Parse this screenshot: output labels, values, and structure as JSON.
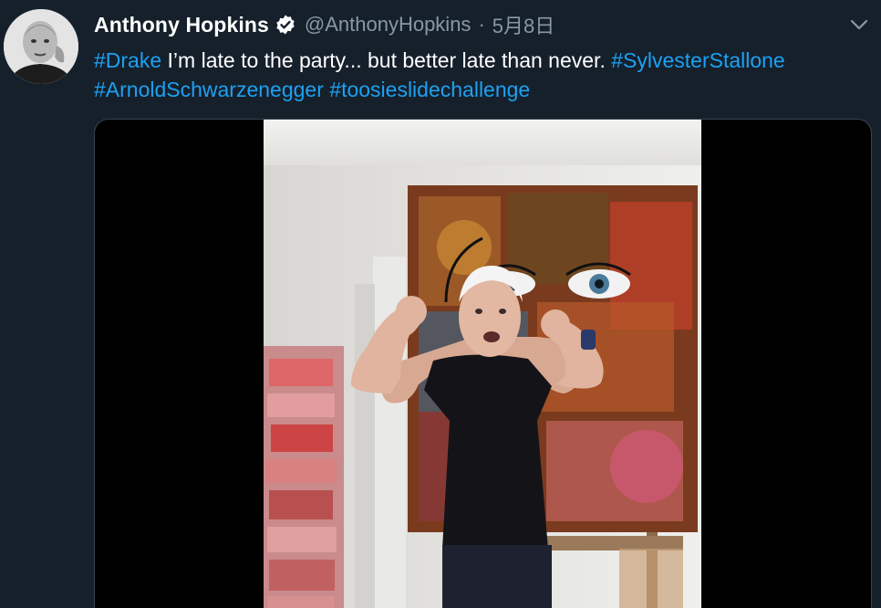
{
  "author": {
    "display_name": "Anthony Hopkins",
    "handle": "@AnthonyHopkins",
    "separator": "·",
    "date": "5月8日",
    "verified": true,
    "avatar_icon": "profile-photo"
  },
  "tweet": {
    "segments": [
      {
        "text": "#Drake",
        "type": "hashtag"
      },
      {
        "text": " I’m late to the party... but better late than never. ",
        "type": "text"
      },
      {
        "text": "#SylvesterStallone",
        "type": "hashtag"
      },
      {
        "text": " ",
        "type": "text"
      },
      {
        "text": "#ArnoldSchwarzenegger",
        "type": "hashtag"
      },
      {
        "text": " ",
        "type": "text"
      },
      {
        "text": "#toosieslidechallenge",
        "type": "hashtag"
      }
    ]
  },
  "media": {
    "type": "video",
    "description_icon": "video-thumbnail"
  },
  "icons": {
    "verified": "verified-badge-icon",
    "more": "chevron-down-icon"
  },
  "colors": {
    "background": "#15202b",
    "text": "#ffffff",
    "secondary_text": "#8899a6",
    "link": "#1da1f2",
    "media_border": "#38444d"
  }
}
